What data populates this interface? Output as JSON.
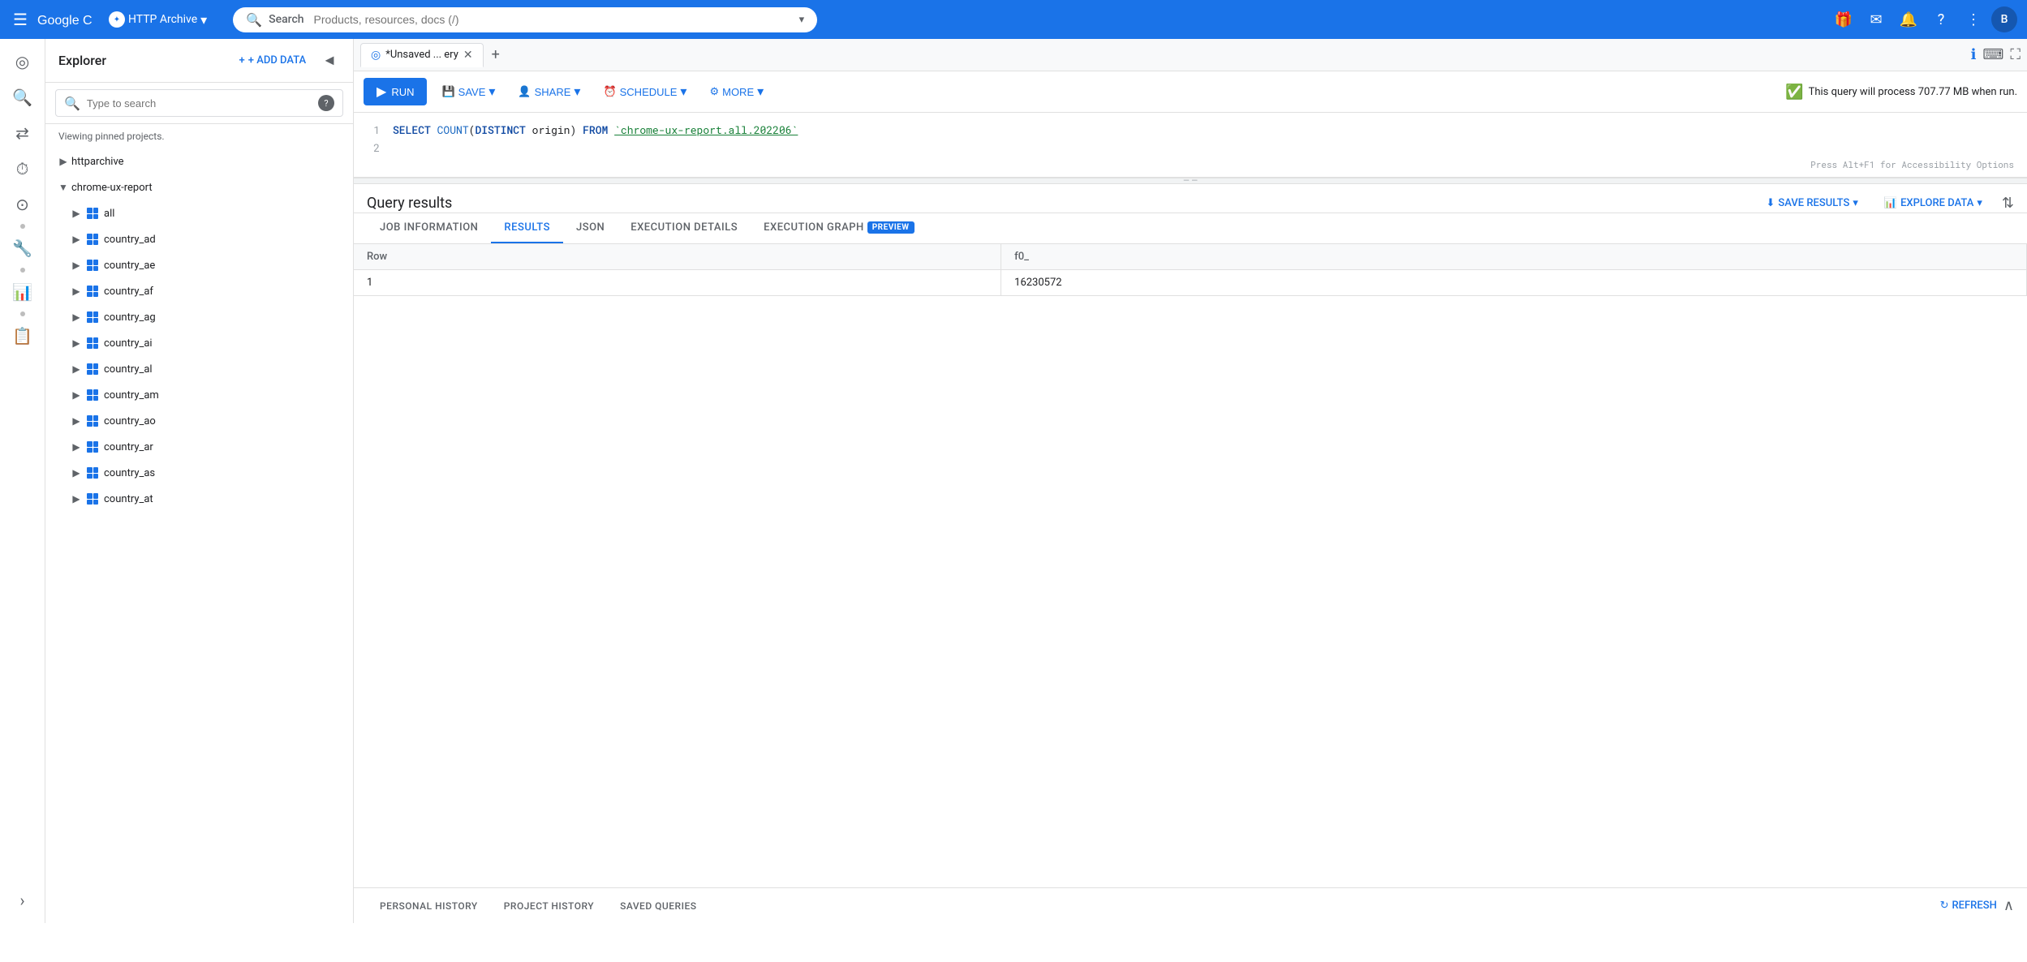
{
  "topNav": {
    "hamburger": "☰",
    "logoText": "Google Cloud",
    "projectName": "HTTP Archive",
    "searchPlaceholder": "Search  Products, resources, docs (/)",
    "searchExpandIcon": "▼",
    "icons": [
      "🎁",
      "✉",
      "🔔",
      "?",
      "⋮"
    ],
    "avatarText": "B"
  },
  "sideIcons": {
    "icons": [
      {
        "name": "analytics-icon",
        "symbol": "◎",
        "active": false
      },
      {
        "name": "search-nav-icon",
        "symbol": "🔍",
        "active": true
      },
      {
        "name": "transfer-icon",
        "symbol": "⇄",
        "active": false
      },
      {
        "name": "history-icon",
        "symbol": "⏱",
        "active": false
      },
      {
        "name": "connections-icon",
        "symbol": "⊙",
        "active": false
      },
      {
        "name": "settings-icon",
        "symbol": "🔧",
        "active": false
      },
      {
        "name": "dot1",
        "symbol": "•",
        "active": false
      },
      {
        "name": "reports-icon",
        "symbol": "📊",
        "active": false
      },
      {
        "name": "dot2",
        "symbol": "•",
        "active": false
      },
      {
        "name": "clipboard-icon",
        "symbol": "📋",
        "active": false
      },
      {
        "name": "expand-icon",
        "symbol": "›",
        "active": false
      }
    ]
  },
  "explorer": {
    "title": "Explorer",
    "addDataLabel": "+ ADD DATA",
    "collapseIcon": "◄",
    "searchPlaceholder": "Type to search",
    "helpIcon": "?",
    "pinnedLabel": "Viewing pinned projects.",
    "items": [
      {
        "id": "httparchive",
        "label": "httparchive",
        "level": 0,
        "expanded": false,
        "hasPin": false,
        "hasMore": true,
        "type": "project"
      },
      {
        "id": "chrome-ux-report",
        "label": "chrome-ux-report",
        "level": 0,
        "expanded": true,
        "hasPin": true,
        "hasMore": true,
        "type": "project"
      },
      {
        "id": "all",
        "label": "all",
        "level": 1,
        "expanded": false,
        "hasPin": false,
        "hasMore": true,
        "type": "dataset"
      },
      {
        "id": "country_ad",
        "label": "country_ad",
        "level": 1,
        "expanded": false,
        "hasPin": false,
        "hasMore": true,
        "type": "dataset"
      },
      {
        "id": "country_ae",
        "label": "country_ae",
        "level": 1,
        "expanded": false,
        "hasPin": false,
        "hasMore": true,
        "type": "dataset"
      },
      {
        "id": "country_af",
        "label": "country_af",
        "level": 1,
        "expanded": false,
        "hasPin": false,
        "hasMore": true,
        "type": "dataset"
      },
      {
        "id": "country_ag",
        "label": "country_ag",
        "level": 1,
        "expanded": false,
        "hasPin": false,
        "hasMore": true,
        "type": "dataset"
      },
      {
        "id": "country_ai",
        "label": "country_ai",
        "level": 1,
        "expanded": false,
        "hasPin": false,
        "hasMore": true,
        "type": "dataset"
      },
      {
        "id": "country_al",
        "label": "country_al",
        "level": 1,
        "expanded": false,
        "hasPin": false,
        "hasMore": true,
        "type": "dataset"
      },
      {
        "id": "country_am",
        "label": "country_am",
        "level": 1,
        "expanded": false,
        "hasPin": false,
        "hasMore": true,
        "type": "dataset"
      },
      {
        "id": "country_ao",
        "label": "country_ao",
        "level": 1,
        "expanded": false,
        "hasPin": false,
        "hasMore": true,
        "type": "dataset"
      },
      {
        "id": "country_ar",
        "label": "country_ar",
        "level": 1,
        "expanded": false,
        "hasPin": false,
        "hasMore": true,
        "type": "dataset"
      },
      {
        "id": "country_as",
        "label": "country_as",
        "level": 1,
        "expanded": false,
        "hasPin": false,
        "hasMore": true,
        "type": "dataset"
      },
      {
        "id": "country_at",
        "label": "country_at",
        "level": 1,
        "expanded": false,
        "hasPin": false,
        "hasMore": true,
        "type": "dataset"
      }
    ]
  },
  "queryEditor": {
    "tabLabel": "*Unsaved ... ery",
    "tabIcon": "◎",
    "closeIcon": "✕",
    "addTabIcon": "+",
    "infoIcon": "ℹ",
    "keyboardIcon": "⌨",
    "fullscreenIcon": "⛶",
    "toolbar": {
      "runLabel": "RUN",
      "runIcon": "▶",
      "saveLabel": "SAVE",
      "saveIcon": "💾",
      "shareLabel": "SHARE",
      "shareIcon": "👤",
      "scheduleLabel": "SCHEDULE",
      "scheduleIcon": "⏰",
      "moreLabel": "MORE",
      "moreIcon": "⚙",
      "processInfo": "This query will process 707.77 MB when run.",
      "checkIcon": "✓"
    },
    "code": {
      "line1": "SELECT COUNT(DISTINCT origin) FROM `chrome-ux-report.all.202206`",
      "line2": ""
    }
  },
  "results": {
    "title": "Query results",
    "saveResultsLabel": "SAVE RESULTS",
    "exploreDataLabel": "EXPLORE DATA",
    "tabs": [
      {
        "id": "job-information",
        "label": "JOB INFORMATION",
        "active": false
      },
      {
        "id": "results",
        "label": "RESULTS",
        "active": true
      },
      {
        "id": "json",
        "label": "JSON",
        "active": false
      },
      {
        "id": "execution-details",
        "label": "EXECUTION DETAILS",
        "active": false
      },
      {
        "id": "execution-graph",
        "label": "EXECUTION GRAPH",
        "active": false,
        "badge": "PREVIEW"
      }
    ],
    "table": {
      "columns": [
        "Row",
        "f0_"
      ],
      "rows": [
        {
          "row": "1",
          "value": "16230572"
        }
      ]
    }
  },
  "bottomBar": {
    "tabs": [
      "PERSONAL HISTORY",
      "PROJECT HISTORY",
      "SAVED QUERIES"
    ],
    "refreshLabel": "REFRESH",
    "collapseIcon": "∧"
  },
  "accessibilityNote": "Press Alt+F1 for Accessibility Options"
}
